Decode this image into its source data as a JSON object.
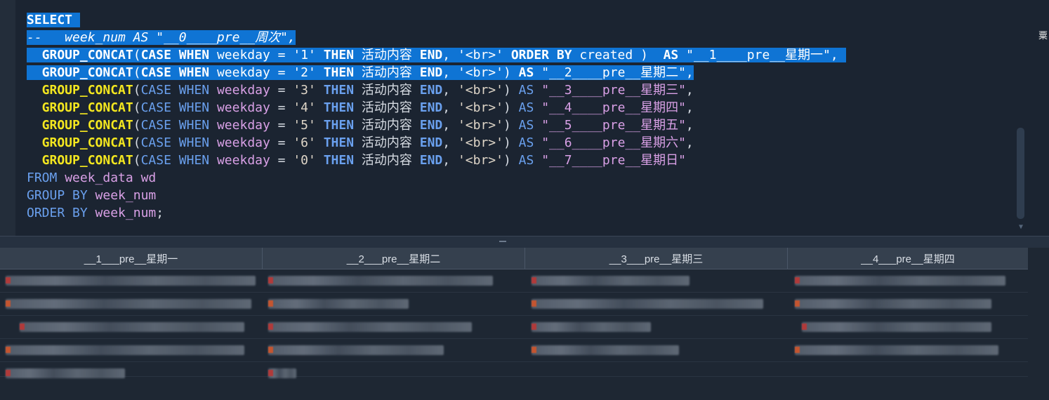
{
  "editor": {
    "lines": [
      {
        "selected": true,
        "tokens": [
          {
            "t": "SELECT",
            "c": "kw"
          },
          {
            "t": " ",
            "c": "plain"
          }
        ]
      },
      {
        "selected": true,
        "tokens": [
          {
            "t": "--   week_num AS \"__0____pre__周次\",",
            "c": "plain cmt"
          }
        ]
      },
      {
        "selected": true,
        "tokens": [
          {
            "t": "  GROUP_CONCAT",
            "c": "fn"
          },
          {
            "t": "(",
            "c": "plain"
          },
          {
            "t": "CASE",
            "c": "kw"
          },
          {
            "t": " ",
            "c": "plain"
          },
          {
            "t": "WHEN",
            "c": "kw"
          },
          {
            "t": " weekday = ",
            "c": "plain"
          },
          {
            "t": "'1'",
            "c": "str"
          },
          {
            "t": " ",
            "c": "plain"
          },
          {
            "t": "THEN",
            "c": "kw"
          },
          {
            "t": " 活动内容 ",
            "c": "plain"
          },
          {
            "t": "END",
            "c": "kw"
          },
          {
            "t": ", ",
            "c": "plain"
          },
          {
            "t": "'<br>'",
            "c": "str"
          },
          {
            "t": " ",
            "c": "plain"
          },
          {
            "t": "ORDER BY",
            "c": "kw"
          },
          {
            "t": " created )  ",
            "c": "plain"
          },
          {
            "t": "AS",
            "c": "kw"
          },
          {
            "t": " \"__1____pre__星期一\", ",
            "c": "plain"
          }
        ]
      },
      {
        "selected": true,
        "tokens": [
          {
            "t": "  GROUP_CONCAT",
            "c": "fn"
          },
          {
            "t": "(",
            "c": "plain"
          },
          {
            "t": "CASE",
            "c": "kw"
          },
          {
            "t": " ",
            "c": "plain"
          },
          {
            "t": "WHEN",
            "c": "kw"
          },
          {
            "t": " weekday = ",
            "c": "plain"
          },
          {
            "t": "'2'",
            "c": "str"
          },
          {
            "t": " ",
            "c": "plain"
          },
          {
            "t": "THEN",
            "c": "kw"
          },
          {
            "t": " 活动内容 ",
            "c": "plain"
          },
          {
            "t": "END",
            "c": "kw"
          },
          {
            "t": ", ",
            "c": "plain"
          },
          {
            "t": "'<br>'",
            "c": "str"
          },
          {
            "t": ") ",
            "c": "plain"
          },
          {
            "t": "AS",
            "c": "kw"
          },
          {
            "t": " \"__2____pre__星期二\",",
            "c": "plain"
          }
        ]
      },
      {
        "selected": false,
        "tokens": [
          {
            "t": "  GROUP_CONCAT",
            "c": "fn"
          },
          {
            "t": "(",
            "c": "plain"
          },
          {
            "t": "CASE",
            "c": "kwf"
          },
          {
            "t": " ",
            "c": "plain"
          },
          {
            "t": "WHEN",
            "c": "kwf"
          },
          {
            "t": " ",
            "c": "plain"
          },
          {
            "t": "weekday",
            "c": "col"
          },
          {
            "t": " = ",
            "c": "plain"
          },
          {
            "t": "'3'",
            "c": "str"
          },
          {
            "t": " ",
            "c": "plain"
          },
          {
            "t": "THEN",
            "c": "kw"
          },
          {
            "t": " 活动内容 ",
            "c": "plain"
          },
          {
            "t": "END",
            "c": "kw"
          },
          {
            "t": ", ",
            "c": "plain"
          },
          {
            "t": "'<br>'",
            "c": "str"
          },
          {
            "t": ") ",
            "c": "plain"
          },
          {
            "t": "AS",
            "c": "kwf"
          },
          {
            "t": " ",
            "c": "plain"
          },
          {
            "t": "\"__3____pre__星期三\"",
            "c": "alias"
          },
          {
            "t": ",",
            "c": "plain"
          }
        ]
      },
      {
        "selected": false,
        "tokens": [
          {
            "t": "  GROUP_CONCAT",
            "c": "fn"
          },
          {
            "t": "(",
            "c": "plain"
          },
          {
            "t": "CASE",
            "c": "kwf"
          },
          {
            "t": " ",
            "c": "plain"
          },
          {
            "t": "WHEN",
            "c": "kwf"
          },
          {
            "t": " ",
            "c": "plain"
          },
          {
            "t": "weekday",
            "c": "col"
          },
          {
            "t": " = ",
            "c": "plain"
          },
          {
            "t": "'4'",
            "c": "str"
          },
          {
            "t": " ",
            "c": "plain"
          },
          {
            "t": "THEN",
            "c": "kw"
          },
          {
            "t": " 活动内容 ",
            "c": "plain"
          },
          {
            "t": "END",
            "c": "kw"
          },
          {
            "t": ", ",
            "c": "plain"
          },
          {
            "t": "'<br>'",
            "c": "str"
          },
          {
            "t": ") ",
            "c": "plain"
          },
          {
            "t": "AS",
            "c": "kwf"
          },
          {
            "t": " ",
            "c": "plain"
          },
          {
            "t": "\"__4____pre__星期四\"",
            "c": "alias"
          },
          {
            "t": ",",
            "c": "plain"
          }
        ]
      },
      {
        "selected": false,
        "tokens": [
          {
            "t": "  GROUP_CONCAT",
            "c": "fn"
          },
          {
            "t": "(",
            "c": "plain"
          },
          {
            "t": "CASE",
            "c": "kwf"
          },
          {
            "t": " ",
            "c": "plain"
          },
          {
            "t": "WHEN",
            "c": "kwf"
          },
          {
            "t": " ",
            "c": "plain"
          },
          {
            "t": "weekday",
            "c": "col"
          },
          {
            "t": " = ",
            "c": "plain"
          },
          {
            "t": "'5'",
            "c": "str"
          },
          {
            "t": " ",
            "c": "plain"
          },
          {
            "t": "THEN",
            "c": "kw"
          },
          {
            "t": " 活动内容 ",
            "c": "plain"
          },
          {
            "t": "END",
            "c": "kw"
          },
          {
            "t": ", ",
            "c": "plain"
          },
          {
            "t": "'<br>'",
            "c": "str"
          },
          {
            "t": ") ",
            "c": "plain"
          },
          {
            "t": "AS",
            "c": "kwf"
          },
          {
            "t": " ",
            "c": "plain"
          },
          {
            "t": "\"__5____pre__星期五\"",
            "c": "alias"
          },
          {
            "t": ",",
            "c": "plain"
          }
        ]
      },
      {
        "selected": false,
        "tokens": [
          {
            "t": "  GROUP_CONCAT",
            "c": "fn"
          },
          {
            "t": "(",
            "c": "plain"
          },
          {
            "t": "CASE",
            "c": "kwf"
          },
          {
            "t": " ",
            "c": "plain"
          },
          {
            "t": "WHEN",
            "c": "kwf"
          },
          {
            "t": " ",
            "c": "plain"
          },
          {
            "t": "weekday",
            "c": "col"
          },
          {
            "t": " = ",
            "c": "plain"
          },
          {
            "t": "'6'",
            "c": "str"
          },
          {
            "t": " ",
            "c": "plain"
          },
          {
            "t": "THEN",
            "c": "kw"
          },
          {
            "t": " 活动内容 ",
            "c": "plain"
          },
          {
            "t": "END",
            "c": "kw"
          },
          {
            "t": ", ",
            "c": "plain"
          },
          {
            "t": "'<br>'",
            "c": "str"
          },
          {
            "t": ") ",
            "c": "plain"
          },
          {
            "t": "AS",
            "c": "kwf"
          },
          {
            "t": " ",
            "c": "plain"
          },
          {
            "t": "\"__6____pre__星期六\"",
            "c": "alias"
          },
          {
            "t": ",",
            "c": "plain"
          }
        ]
      },
      {
        "selected": false,
        "tokens": [
          {
            "t": "  GROUP_CONCAT",
            "c": "fn"
          },
          {
            "t": "(",
            "c": "plain"
          },
          {
            "t": "CASE",
            "c": "kwf"
          },
          {
            "t": " ",
            "c": "plain"
          },
          {
            "t": "WHEN",
            "c": "kwf"
          },
          {
            "t": " ",
            "c": "plain"
          },
          {
            "t": "weekday",
            "c": "col"
          },
          {
            "t": " = ",
            "c": "plain"
          },
          {
            "t": "'0'",
            "c": "str"
          },
          {
            "t": " ",
            "c": "plain"
          },
          {
            "t": "THEN",
            "c": "kw"
          },
          {
            "t": " 活动内容 ",
            "c": "plain"
          },
          {
            "t": "END",
            "c": "kw"
          },
          {
            "t": ", ",
            "c": "plain"
          },
          {
            "t": "'<br>'",
            "c": "str"
          },
          {
            "t": ") ",
            "c": "plain"
          },
          {
            "t": "AS",
            "c": "kwf"
          },
          {
            "t": " ",
            "c": "plain"
          },
          {
            "t": "\"__7____pre__星期日\"",
            "c": "alias"
          }
        ]
      },
      {
        "selected": false,
        "tokens": [
          {
            "t": "FROM",
            "c": "kwf"
          },
          {
            "t": " ",
            "c": "plain"
          },
          {
            "t": "week_data wd",
            "c": "col"
          }
        ]
      },
      {
        "selected": false,
        "tokens": [
          {
            "t": "GROUP BY",
            "c": "kwf"
          },
          {
            "t": " ",
            "c": "plain"
          },
          {
            "t": "week_num",
            "c": "col"
          }
        ]
      },
      {
        "selected": false,
        "tokens": [
          {
            "t": "ORDER BY",
            "c": "kwf"
          },
          {
            "t": " ",
            "c": "plain"
          },
          {
            "t": "week_num",
            "c": "col"
          },
          {
            "t": ";",
            "c": "plain"
          }
        ]
      }
    ]
  },
  "results": {
    "columns": [
      "__1___pre__星期一",
      "__2___pre__星期二",
      "__3___pre__星期三",
      "__4___pre__星期四"
    ],
    "edge_char": "粟"
  },
  "colors": {
    "editor_bg": "#1b2431",
    "selection": "#0f74d4",
    "keyword": "#6aa0ee",
    "function": "#f4e71f",
    "identifier": "#d9a0e6",
    "grid_header": "#35404e"
  }
}
